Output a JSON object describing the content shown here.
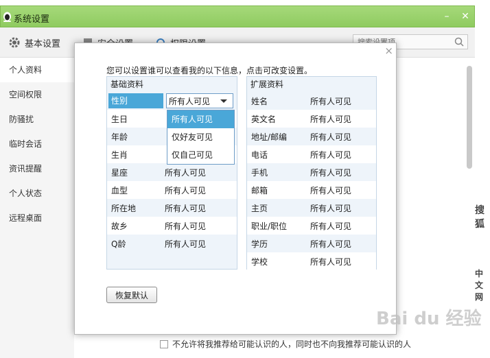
{
  "window": {
    "title": "系统设置",
    "minimize_label": "–",
    "close_label": "✕"
  },
  "tabs": [
    {
      "label": "基本设置",
      "icon": "gear-icon"
    },
    {
      "label": "安全设置",
      "icon": "shield-icon"
    },
    {
      "label": "权限设置",
      "icon": "lock-icon"
    }
  ],
  "search": {
    "placeholder": "搜索设置项"
  },
  "sidebar": {
    "items": [
      {
        "label": "个人资料"
      },
      {
        "label": "空间权限"
      },
      {
        "label": "防骚扰"
      },
      {
        "label": "临时会话"
      },
      {
        "label": "资讯提醒"
      },
      {
        "label": "个人状态"
      },
      {
        "label": "远程桌面"
      }
    ]
  },
  "background": {
    "bottom_option": "不允许将我推荐给可能认识的人，同时也不向我推荐可能认识的人",
    "ad1": "搜狐",
    "ad2": "中文网",
    "watermark": "Bai du 经验"
  },
  "modal": {
    "close_label": "×",
    "intro": "您可以设置谁可以查看我的以下信息，点击可改变设置。",
    "basic": {
      "title": "基础资料",
      "rows": [
        {
          "label": "性别",
          "value": "所有人可见"
        },
        {
          "label": "生日",
          "value": ""
        },
        {
          "label": "年龄",
          "value": ""
        },
        {
          "label": "生肖",
          "value": ""
        },
        {
          "label": "星座",
          "value": "所有人可见"
        },
        {
          "label": "血型",
          "value": "所有人可见"
        },
        {
          "label": "所在地",
          "value": "所有人可见"
        },
        {
          "label": "故乡",
          "value": "所有人可见"
        },
        {
          "label": "Q龄",
          "value": "所有人可见"
        }
      ]
    },
    "extended": {
      "title": "扩展资料",
      "rows": [
        {
          "label": "姓名",
          "value": "所有人可见"
        },
        {
          "label": "英文名",
          "value": "所有人可见"
        },
        {
          "label": "地址/邮编",
          "value": "所有人可见"
        },
        {
          "label": "电话",
          "value": "所有人可见"
        },
        {
          "label": "手机",
          "value": "所有人可见"
        },
        {
          "label": "邮箱",
          "value": "所有人可见"
        },
        {
          "label": "主页",
          "value": "所有人可见"
        },
        {
          "label": "职业/职位",
          "value": "所有人可见"
        },
        {
          "label": "学历",
          "value": "所有人可见"
        },
        {
          "label": "学校",
          "value": "所有人可见"
        }
      ]
    },
    "dropdown_options": [
      "所有人可见",
      "仅好友可见",
      "仅自己可见"
    ],
    "reset_label": "恢复默认"
  },
  "colors": {
    "titlebar": "#8fcb60",
    "selection": "#4aa7d8",
    "panel_bg": "#eef4fa"
  }
}
